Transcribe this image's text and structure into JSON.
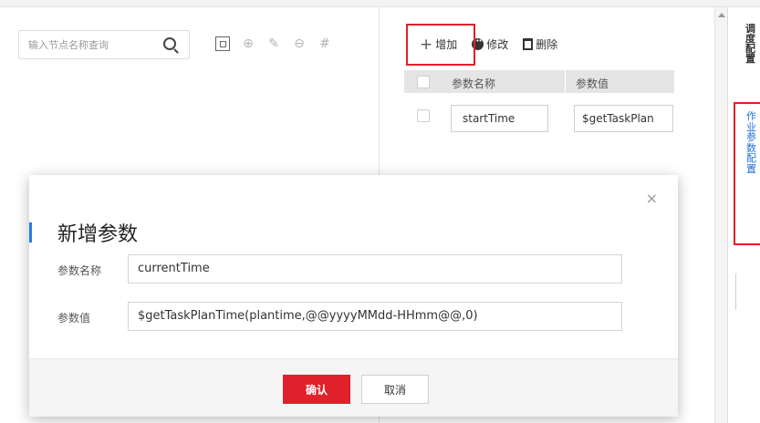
{
  "search": {
    "placeholder": "输入节点名称查询"
  },
  "tree_tools": {
    "icons": [
      "fit-screen-icon",
      "zoom-in-icon",
      "edit-node-icon",
      "zoom-out-icon",
      "grid-icon"
    ]
  },
  "toolbar": {
    "add_label": "增加",
    "edit_label": "修改",
    "delete_label": "删除"
  },
  "param_table": {
    "headers": {
      "name": "参数名称",
      "value": "参数值"
    },
    "rows": [
      {
        "name": "startTime",
        "value": "$getTaskPlan"
      }
    ]
  },
  "side_panel": {
    "title": "调度配置",
    "link": "作业参数配置"
  },
  "modal": {
    "title": "新增参数",
    "name_label": "参数名称",
    "name_value": "currentTime",
    "value_label": "参数值",
    "value_value": "$getTaskPlanTime(plantime,@@yyyyMMdd-HHmm@@,0)",
    "ok_label": "确认",
    "cancel_label": "取消",
    "close_glyph": "×"
  },
  "colors": {
    "accent_red": "#e0202a",
    "link_blue": "#1e6fd9",
    "accent_bar": "#2a7ae2"
  }
}
